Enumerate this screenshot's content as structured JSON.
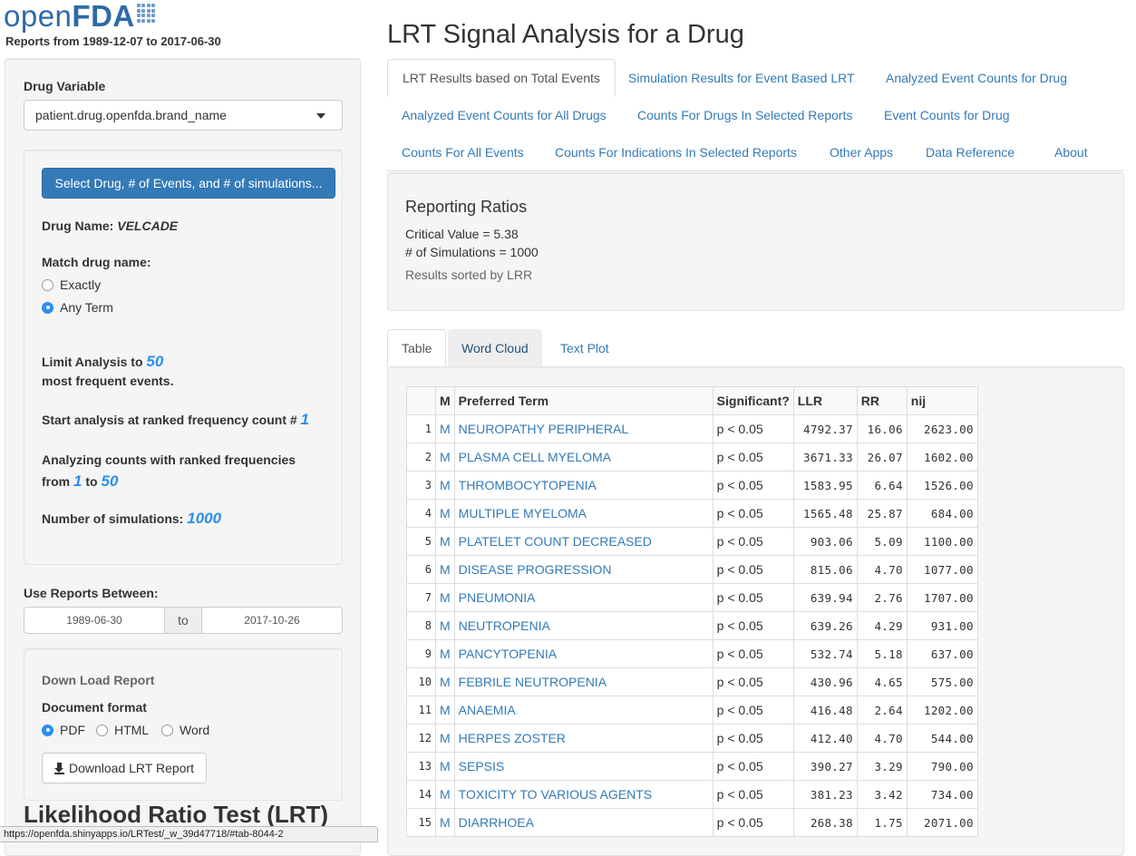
{
  "brand": {
    "open": "open",
    "fda": "FDA"
  },
  "subtitle": "Reports from 1989-12-07 to 2017-06-30",
  "sidebar": {
    "drug_variable_label": "Drug Variable",
    "drug_variable_value": "patient.drug.openfda.brand_name",
    "select_button": "Select Drug, # of Events, and # of simulations...",
    "drug_name_label": "Drug Name:",
    "drug_name_value": "VELCADE",
    "match_label": "Match drug name:",
    "match_options": [
      "Exactly",
      "Any Term"
    ],
    "match_selected": "Any Term",
    "limit_pre": "Limit Analysis to",
    "limit_value": "50",
    "limit_post": "most frequent events.",
    "start_pre": "Start analysis at ranked frequency count #",
    "start_value": "1",
    "range_line1": "Analyzing counts with ranked frequencies",
    "range_from": "from",
    "range_start": "1",
    "range_to": "to",
    "range_end": "50",
    "sims_label": "Number of simulations:",
    "sims_value": "1000",
    "reports_between_label": "Use Reports Between:",
    "date_from": "1989-06-30",
    "date_to_label": "to",
    "date_to": "2017-10-26",
    "download_title": "Down Load Report",
    "doc_format_label": "Document format",
    "formats": [
      "PDF",
      "HTML",
      "Word"
    ],
    "format_selected": "PDF",
    "download_button": "Download LRT Report",
    "bottom_heading": "Likelihood Ratio Test (LRT)"
  },
  "status_url": "https://openfda.shinyapps.io/LRTest/_w_39d47718/#tab-8044-2",
  "main": {
    "title": "LRT Signal Analysis for a Drug",
    "tabs": [
      "LRT Results based on Total Events",
      "Simulation Results for Event Based LRT",
      "Analyzed Event Counts for Drug",
      "Analyzed Event Counts for All Drugs",
      "Counts For Drugs In Selected Reports",
      "Event Counts for Drug",
      "Counts For All Events",
      "Counts For Indications In Selected Reports",
      "Other Apps",
      "Data Reference",
      "About"
    ],
    "active_tab": "LRT Results based on Total Events",
    "ratios": {
      "heading": "Reporting Ratios",
      "critical": "Critical Value = 5.38",
      "sims": "# of Simulations = 1000",
      "sorted": "Results sorted by LRR"
    },
    "subtabs": [
      "Table",
      "Word Cloud",
      "Text Plot"
    ],
    "active_subtab": "Table",
    "table": {
      "headers": [
        "",
        "M",
        "Preferred Term",
        "Significant?",
        "LLR",
        "RR",
        "nij"
      ],
      "rows": [
        [
          "1",
          "M",
          "NEUROPATHY PERIPHERAL",
          "p < 0.05",
          "4792.37",
          "16.06",
          "2623.00"
        ],
        [
          "2",
          "M",
          "PLASMA CELL MYELOMA",
          "p < 0.05",
          "3671.33",
          "26.07",
          "1602.00"
        ],
        [
          "3",
          "M",
          "THROMBOCYTOPENIA",
          "p < 0.05",
          "1583.95",
          "6.64",
          "1526.00"
        ],
        [
          "4",
          "M",
          "MULTIPLE MYELOMA",
          "p < 0.05",
          "1565.48",
          "25.87",
          "684.00"
        ],
        [
          "5",
          "M",
          "PLATELET COUNT DECREASED",
          "p < 0.05",
          "903.06",
          "5.09",
          "1100.00"
        ],
        [
          "6",
          "M",
          "DISEASE PROGRESSION",
          "p < 0.05",
          "815.06",
          "4.70",
          "1077.00"
        ],
        [
          "7",
          "M",
          "PNEUMONIA",
          "p < 0.05",
          "639.94",
          "2.76",
          "1707.00"
        ],
        [
          "8",
          "M",
          "NEUTROPENIA",
          "p < 0.05",
          "639.26",
          "4.29",
          "931.00"
        ],
        [
          "9",
          "M",
          "PANCYTOPENIA",
          "p < 0.05",
          "532.74",
          "5.18",
          "637.00"
        ],
        [
          "10",
          "M",
          "FEBRILE NEUTROPENIA",
          "p < 0.05",
          "430.96",
          "4.65",
          "575.00"
        ],
        [
          "11",
          "M",
          "ANAEMIA",
          "p < 0.05",
          "416.48",
          "2.64",
          "1202.00"
        ],
        [
          "12",
          "M",
          "HERPES ZOSTER",
          "p < 0.05",
          "412.40",
          "4.70",
          "544.00"
        ],
        [
          "13",
          "M",
          "SEPSIS",
          "p < 0.05",
          "390.27",
          "3.29",
          "790.00"
        ],
        [
          "14",
          "M",
          "TOXICITY TO VARIOUS AGENTS",
          "p < 0.05",
          "381.23",
          "3.42",
          "734.00"
        ],
        [
          "15",
          "M",
          "DIARRHOEA",
          "p < 0.05",
          "268.38",
          "1.75",
          "2071.00"
        ]
      ]
    }
  },
  "colors": {
    "accent": "#337ab7",
    "highlight": "#2a8ef0",
    "well": "#f5f5f5"
  }
}
